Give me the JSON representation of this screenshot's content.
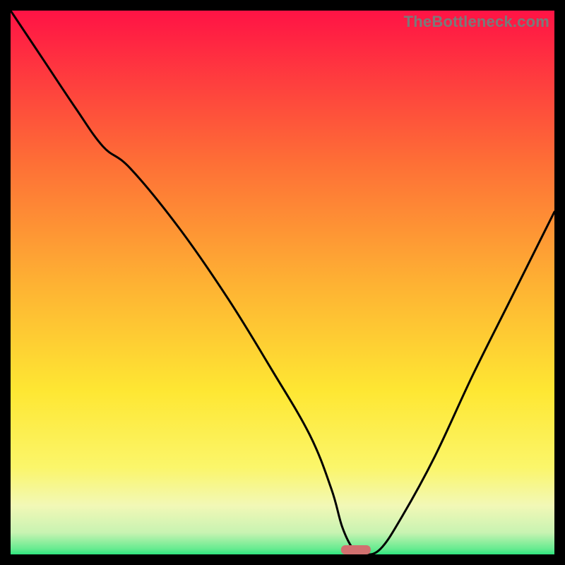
{
  "watermark": "TheBottleneck.com",
  "colors": {
    "frame": "#000000",
    "line": "#000000",
    "marker": "#d1706f",
    "gradient_top": "#ff1345",
    "gradient_mid1": "#fe8c34",
    "gradient_mid2": "#fee733",
    "gradient_mid3": "#f4f89a",
    "gradient_bottom_band": "#d8f6b6",
    "gradient_min": "#2ee57e"
  },
  "chart_data": {
    "type": "line",
    "title": "",
    "xlabel": "",
    "ylabel": "",
    "xlim": [
      0,
      100
    ],
    "ylim": [
      0,
      100
    ],
    "x": [
      0,
      6,
      12,
      17,
      22,
      31,
      40,
      48,
      55,
      59,
      61,
      63,
      65,
      68,
      72,
      78,
      85,
      92,
      100
    ],
    "values": [
      100,
      91,
      82,
      75,
      71,
      60,
      47,
      34,
      22,
      12,
      5,
      1,
      0,
      1,
      7,
      18,
      33,
      47,
      63
    ],
    "marker": {
      "x": 63.5,
      "y": 0
    },
    "notes": "V-shaped bottleneck curve; minimum ≈ 0 at x ≈ 63; left branch starts at 100 (top-left), right branch rises to ≈ 63 at x=100."
  }
}
